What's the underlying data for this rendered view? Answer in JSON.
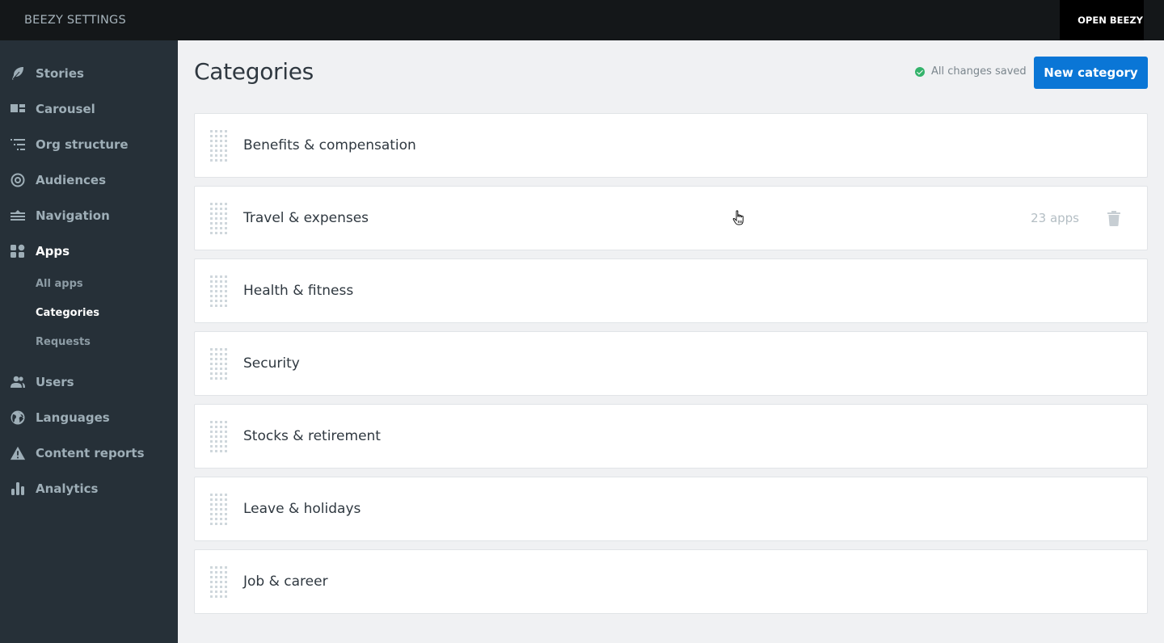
{
  "header": {
    "app_title": "BEEZY SETTINGS",
    "open_button": "OPEN BEEZY"
  },
  "sidebar": {
    "items": [
      {
        "label": "Stories",
        "icon": "feather-icon",
        "active": false
      },
      {
        "label": "Carousel",
        "icon": "carousel-icon",
        "active": false
      },
      {
        "label": "Org structure",
        "icon": "org-structure-icon",
        "active": false
      },
      {
        "label": "Audiences",
        "icon": "target-icon",
        "active": false
      },
      {
        "label": "Navigation",
        "icon": "navigation-icon",
        "active": false
      },
      {
        "label": "Apps",
        "icon": "apps-grid-icon",
        "active": true
      },
      {
        "label": "Users",
        "icon": "users-icon",
        "active": false
      },
      {
        "label": "Languages",
        "icon": "globe-icon",
        "active": false
      },
      {
        "label": "Content reports",
        "icon": "warning-icon",
        "active": false
      },
      {
        "label": "Analytics",
        "icon": "bar-chart-icon",
        "active": false
      }
    ],
    "apps_subitems": [
      {
        "label": "All apps",
        "active": false
      },
      {
        "label": "Categories",
        "active": true
      },
      {
        "label": "Requests",
        "active": false
      }
    ]
  },
  "main": {
    "title": "Categories",
    "save_status": "All changes saved",
    "new_button": "New category",
    "categories": [
      {
        "name": "Benefits & compensation",
        "count": ""
      },
      {
        "name": "Travel & expenses",
        "count": "23 apps"
      },
      {
        "name": "Health & fitness",
        "count": ""
      },
      {
        "name": "Security",
        "count": ""
      },
      {
        "name": "Stocks & retirement",
        "count": ""
      },
      {
        "name": "Leave & holidays",
        "count": ""
      },
      {
        "name": "Job & career",
        "count": ""
      }
    ]
  },
  "colors": {
    "topbar": "#141719",
    "sidebar": "#263038",
    "accent": "#0a76d6",
    "success": "#34b36b",
    "background": "#f0f1f3"
  }
}
